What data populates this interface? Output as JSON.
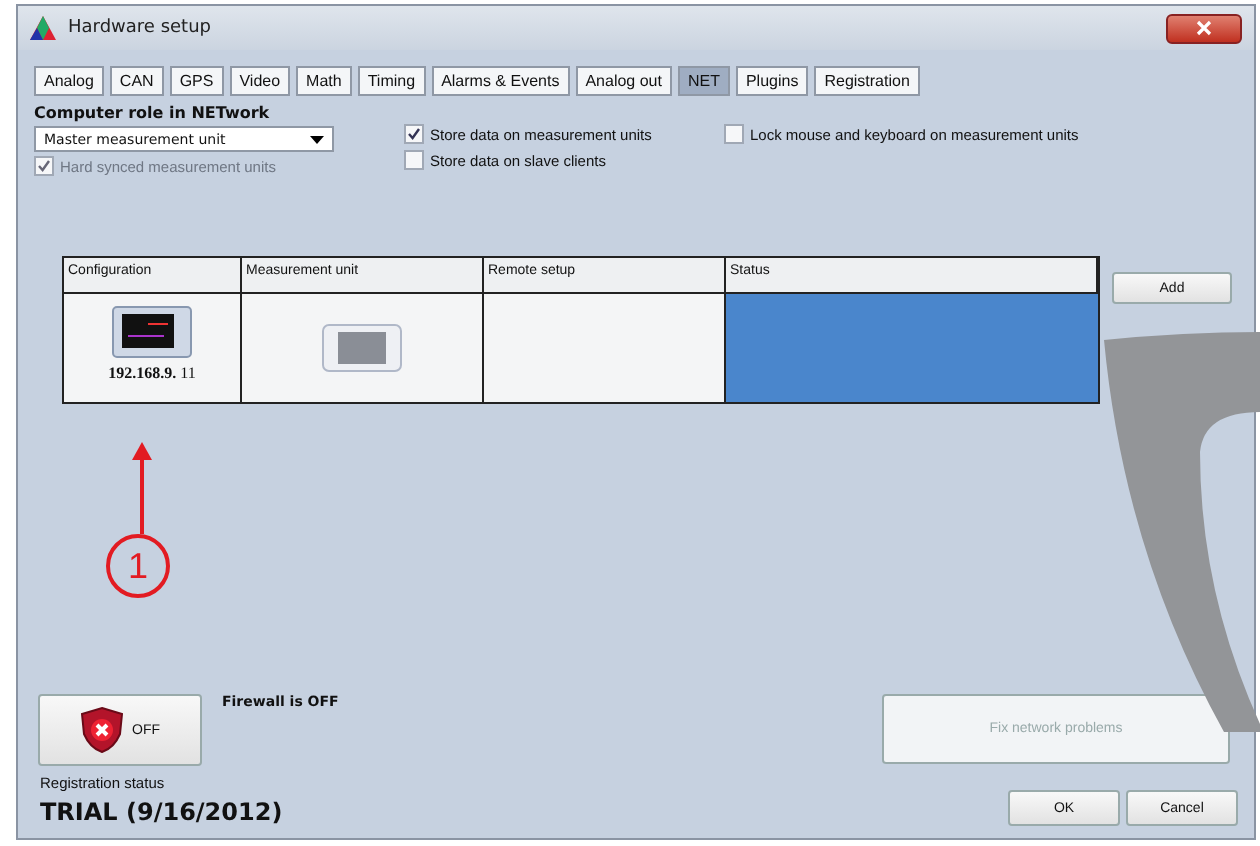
{
  "window": {
    "title": "Hardware setup"
  },
  "tabs": [
    {
      "label": "Analog",
      "selected": false
    },
    {
      "label": "CAN",
      "selected": false
    },
    {
      "label": "GPS",
      "selected": false
    },
    {
      "label": "Video",
      "selected": false
    },
    {
      "label": "Math",
      "selected": false
    },
    {
      "label": "Timing",
      "selected": false
    },
    {
      "label": "Alarms & Events",
      "selected": false
    },
    {
      "label": "Analog out",
      "selected": false
    },
    {
      "label": "NET",
      "selected": true
    },
    {
      "label": "Plugins",
      "selected": false
    },
    {
      "label": "Registration",
      "selected": false
    }
  ],
  "role": {
    "label": "Computer role in NETwork",
    "value": "Master measurement unit"
  },
  "hard_synced": {
    "label": "Hard synced measurement units",
    "checked": true,
    "disabled": true
  },
  "options": [
    {
      "label": "Store data on measurement units",
      "checked": true,
      "disabled": false
    },
    {
      "label": "Store data on slave clients",
      "checked": false,
      "disabled": false
    },
    {
      "label": "Lock mouse and keyboard on measurement units",
      "checked": false,
      "disabled": false
    }
  ],
  "table": {
    "columns": [
      "Configuration",
      "Measurement unit",
      "Remote setup",
      "Status"
    ],
    "rows": [
      {
        "address": "**192.168.9.** 11",
        "selected": true
      }
    ]
  },
  "add_button": "Add",
  "annotation": {
    "label": "1"
  },
  "firewall": {
    "button": "OFF",
    "status": "Firewall is OFF"
  },
  "fix_button": {
    "label": "Fix network problems",
    "disabled": true
  },
  "registration": {
    "label": "Registration status",
    "value": "TRIAL (9/16/2012)"
  },
  "buttons": [
    "OK",
    "Cancel"
  ]
}
